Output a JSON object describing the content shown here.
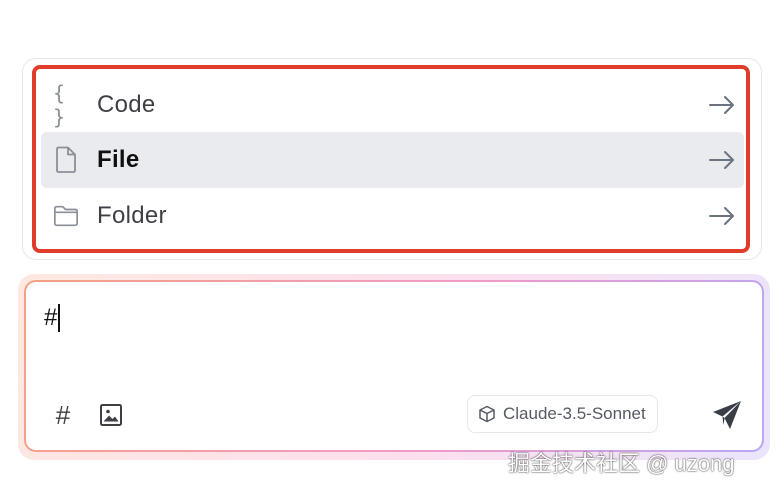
{
  "menu": {
    "items": [
      {
        "label": "Code",
        "icon": "code-braces-icon",
        "active": false
      },
      {
        "label": "File",
        "icon": "file-icon",
        "active": true
      },
      {
        "label": "Folder",
        "icon": "folder-icon",
        "active": false
      }
    ],
    "code_glyph": "{ }",
    "highlight_color": "#e03c2a"
  },
  "composer": {
    "input_value": "#",
    "model_label": "Claude-3.5-Sonnet",
    "hash_glyph": "#"
  },
  "watermark": "掘金技术社区 @ uzong",
  "colors": {
    "gradient_start": "#f3a183",
    "gradient_mid": "#f29ac7",
    "gradient_end": "#b9a7f5",
    "active_row_bg": "#e9ebef"
  }
}
